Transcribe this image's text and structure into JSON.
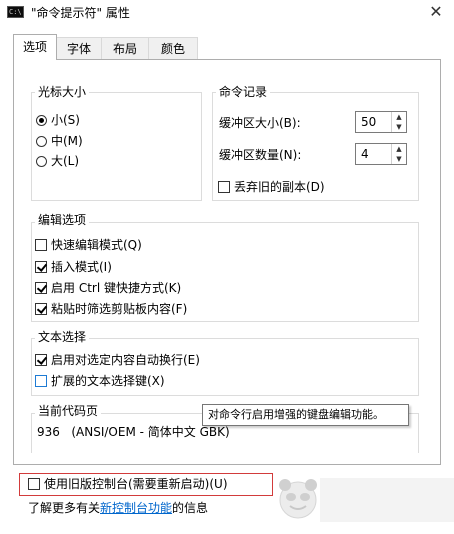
{
  "window": {
    "app_icon_text": "C:\\",
    "title": "\"命令提示符\" 属性",
    "close_glyph": "✕"
  },
  "tabs": [
    {
      "label": "选项",
      "active": true
    },
    {
      "label": "字体",
      "active": false
    },
    {
      "label": "布局",
      "active": false
    },
    {
      "label": "颜色",
      "active": false
    }
  ],
  "cursor_size": {
    "title": "光标大小",
    "options": [
      {
        "label": "小(S)",
        "selected": true
      },
      {
        "label": "中(M)",
        "selected": false
      },
      {
        "label": "大(L)",
        "selected": false
      }
    ]
  },
  "command_history": {
    "title": "命令记录",
    "buffer_size_label": "缓冲区大小(B):",
    "buffer_size_value": "50",
    "buffer_count_label": "缓冲区数量(N):",
    "buffer_count_value": "4",
    "discard_duplicates_label": "丢弃旧的副本(D)",
    "discard_duplicates_checked": false
  },
  "edit_options": {
    "title": "编辑选项",
    "items": [
      {
        "label": "快速编辑模式(Q)",
        "checked": false
      },
      {
        "label": "插入模式(I)",
        "checked": true
      },
      {
        "label": "启用 Ctrl 键快捷方式(K)",
        "checked": true
      },
      {
        "label": "粘贴时筛选剪贴板内容(F)",
        "checked": true
      }
    ]
  },
  "text_selection": {
    "title": "文本选择",
    "items": [
      {
        "label": "启用对选定内容自动换行(E)",
        "checked": true
      },
      {
        "label": "扩展的文本选择键(X)",
        "checked": false
      }
    ]
  },
  "codepage": {
    "title": "当前代码页",
    "value": "936   (ANSI/OEM - 简体中文 GBK)"
  },
  "tooltip": "对命令行启用增强的键盘编辑功能。",
  "legacy": {
    "label": "使用旧版控制台(需要重新启动)(U)",
    "checked": false
  },
  "learn_more": {
    "prefix": "了解更多有关",
    "link": "新控制台功能",
    "suffix": "的信息"
  },
  "colors": {
    "accent_link": "#0066cc",
    "highlight_border": "#d23b3b",
    "focus_checkbox": "#1e7bd4"
  }
}
